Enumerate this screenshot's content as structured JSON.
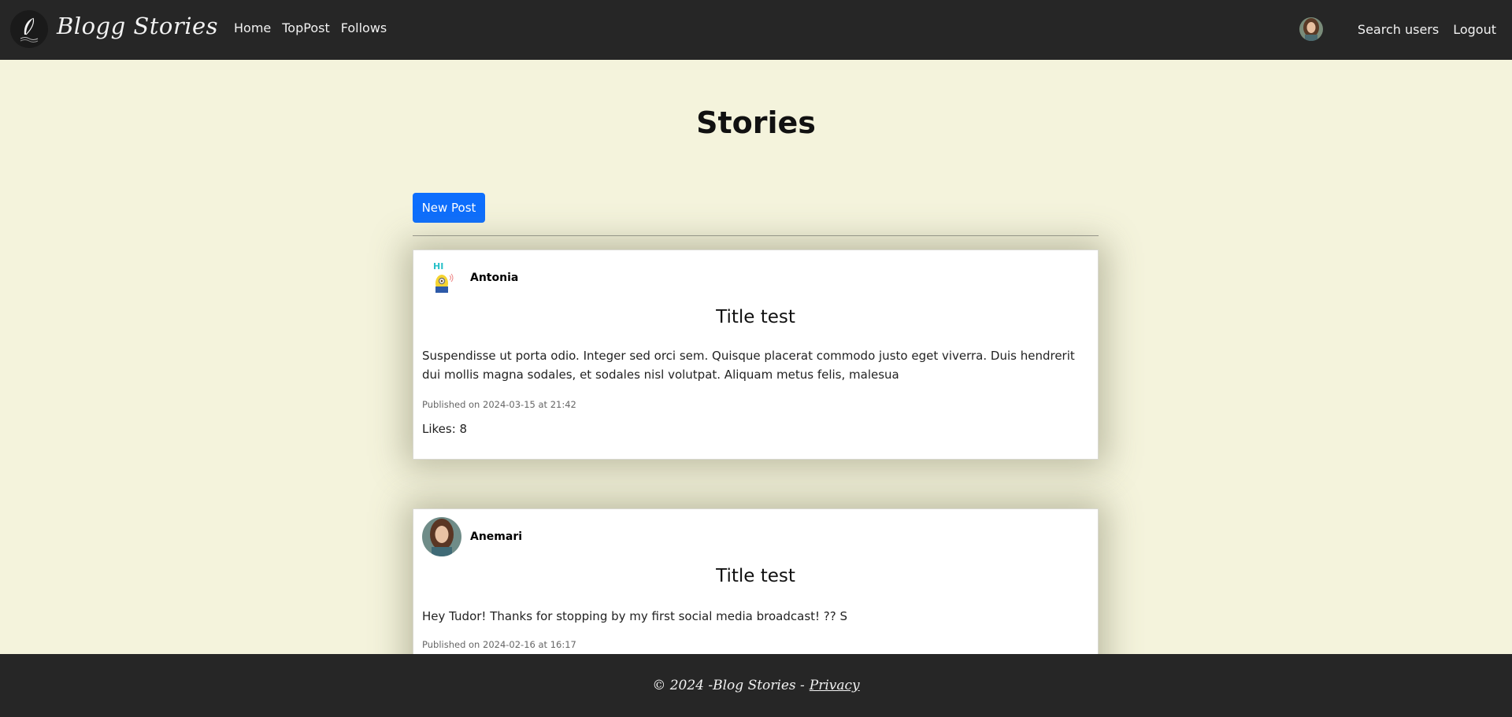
{
  "nav": {
    "brand": "Blogg Stories",
    "links": [
      "Home",
      "TopPost",
      "Follows"
    ],
    "search_users": "Search users",
    "logout": "Logout"
  },
  "main": {
    "title": "Stories",
    "new_post_label": "New Post"
  },
  "posts": [
    {
      "author": "Antonia",
      "title": "Title test",
      "body": "Suspendisse ut porta odio. Integer sed orci sem. Quisque placerat commodo justo eget viverra. Duis hendrerit dui mollis magna sodales, et sodales nisl volutpat. Aliquam metus felis, malesua",
      "published": "Published on 2024-03-15 at 21:42",
      "likes": "Likes: 8"
    },
    {
      "author": "Anemari",
      "title": "Title test",
      "body": "Hey Tudor! Thanks for stopping by my first social media broadcast! ?? S",
      "published": "Published on 2024-02-16 at 16:17"
    }
  ],
  "footer": {
    "text": "© 2024 -Blog Stories -",
    "privacy": "Privacy"
  },
  "colors": {
    "page_bg": "#f4f3dc",
    "navbar_bg": "#262626",
    "primary_button": "#0d6efd"
  }
}
